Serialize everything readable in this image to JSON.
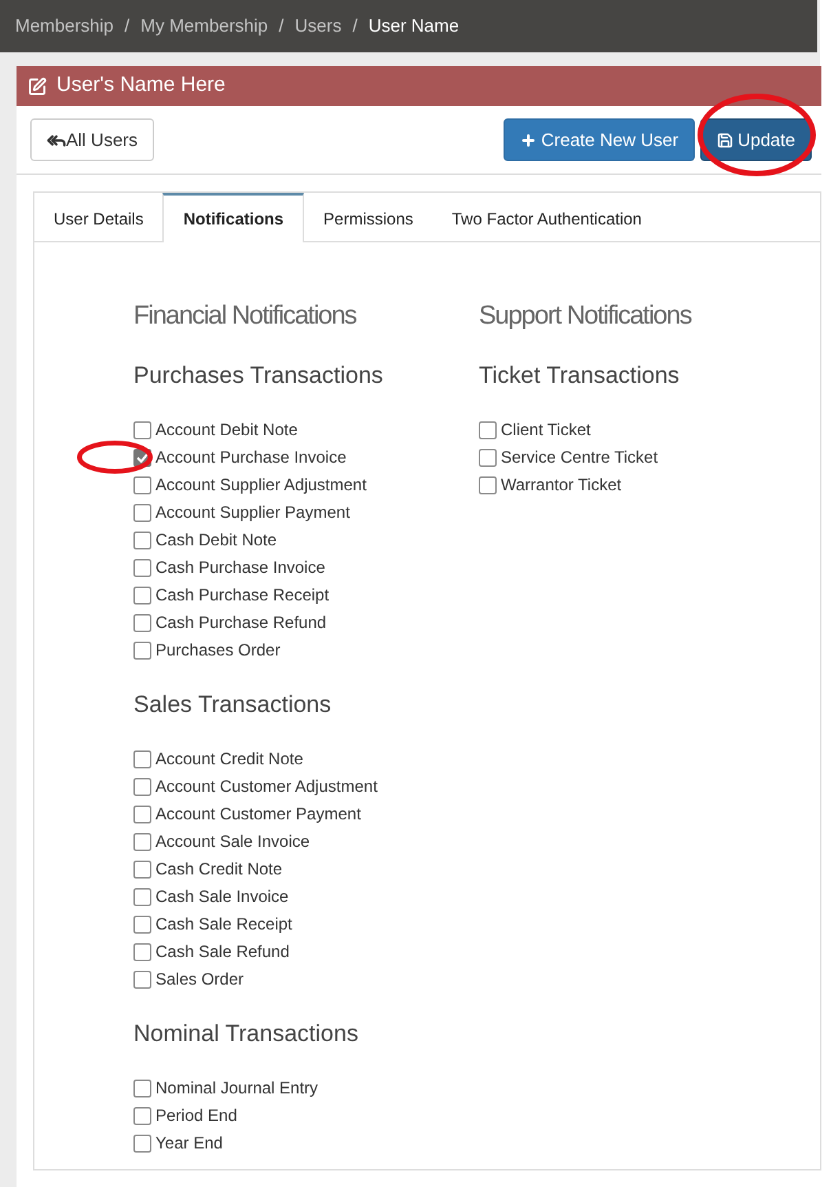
{
  "breadcrumb": {
    "separator": "/",
    "items": [
      {
        "label": "Membership",
        "current": false
      },
      {
        "label": "My Membership",
        "current": false
      },
      {
        "label": "Users",
        "current": false
      },
      {
        "label": "User Name",
        "current": true
      }
    ]
  },
  "panel": {
    "title": "User's Name Here"
  },
  "toolbar": {
    "back_button": {
      "label": "All Users"
    },
    "buttons": [
      {
        "label": "Create New User",
        "kind": "create",
        "circled": false
      },
      {
        "label": "Update",
        "kind": "save",
        "circled": true
      }
    ]
  },
  "tabs": [
    {
      "label": "User Details",
      "selected": false
    },
    {
      "label": "Notifications",
      "selected": true
    },
    {
      "label": "Permissions",
      "selected": false
    },
    {
      "label": "Two Factor Authentication",
      "selected": false
    }
  ],
  "columns": [
    {
      "heading": "Financial Notifications",
      "groups": [
        {
          "title": "Purchases Transactions",
          "items": [
            {
              "label": "Account Debit Note",
              "checked": false,
              "circled": false
            },
            {
              "label": "Account Purchase Invoice",
              "checked": true,
              "circled": true
            },
            {
              "label": "Account Supplier Adjustment",
              "checked": false,
              "circled": false
            },
            {
              "label": "Account Supplier Payment",
              "checked": false,
              "circled": false
            },
            {
              "label": "Cash Debit Note",
              "checked": false,
              "circled": false
            },
            {
              "label": "Cash Purchase Invoice",
              "checked": false,
              "circled": false
            },
            {
              "label": "Cash Purchase Receipt",
              "checked": false,
              "circled": false
            },
            {
              "label": "Cash Purchase Refund",
              "checked": false,
              "circled": false
            },
            {
              "label": "Purchases Order",
              "checked": false,
              "circled": false
            }
          ]
        },
        {
          "title": "Sales Transactions",
          "items": [
            {
              "label": "Account Credit Note",
              "checked": false,
              "circled": false
            },
            {
              "label": "Account Customer Adjustment",
              "checked": false,
              "circled": false
            },
            {
              "label": "Account Customer Payment",
              "checked": false,
              "circled": false
            },
            {
              "label": "Account Sale Invoice",
              "checked": false,
              "circled": false
            },
            {
              "label": "Cash Credit Note",
              "checked": false,
              "circled": false
            },
            {
              "label": "Cash Sale Invoice",
              "checked": false,
              "circled": false
            },
            {
              "label": "Cash Sale Receipt",
              "checked": false,
              "circled": false
            },
            {
              "label": "Cash Sale Refund",
              "checked": false,
              "circled": false
            },
            {
              "label": "Sales Order",
              "checked": false,
              "circled": false
            }
          ]
        },
        {
          "title": "Nominal Transactions",
          "items": [
            {
              "label": "Nominal Journal Entry",
              "checked": false,
              "circled": false
            },
            {
              "label": "Period End",
              "checked": false,
              "circled": false
            },
            {
              "label": "Year End",
              "checked": false,
              "circled": false
            }
          ]
        }
      ]
    },
    {
      "heading": "Support Notifications",
      "groups": [
        {
          "title": "Ticket Transactions",
          "items": [
            {
              "label": "Client Ticket",
              "checked": false,
              "circled": false
            },
            {
              "label": "Service Centre Ticket",
              "checked": false,
              "circled": false
            },
            {
              "label": "Warrantor Ticket",
              "checked": false,
              "circled": false
            }
          ]
        }
      ]
    }
  ]
}
